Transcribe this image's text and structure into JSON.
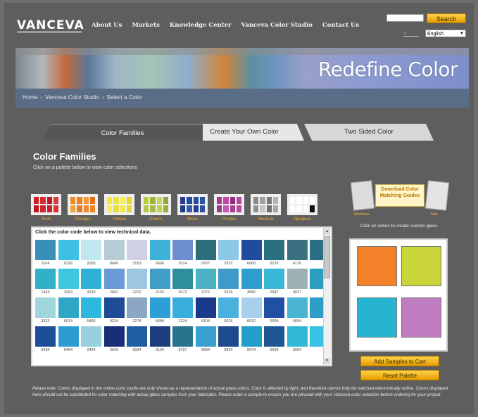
{
  "header": {
    "logo": "VANCEVA",
    "nav": [
      "About Us",
      "Markets",
      "Knowledge Center",
      "Vanceva Color Studio",
      "Contact Us"
    ],
    "search_button": "Search",
    "search_placeholder": "",
    "language": "English"
  },
  "banner": {
    "title": "Redefine Color",
    "breadcrumb": [
      "Home",
      "Vanceva Color Studio",
      "Select a Color"
    ]
  },
  "tabs": [
    "Color Families",
    "Create Your Own Color",
    "Two Sided Color"
  ],
  "section": {
    "title": "Color Families",
    "subtitle": "Click on a palette below to view color selections"
  },
  "palettes": [
    {
      "label": "Reds",
      "colors": [
        "#cc1f2a",
        "#d62a34",
        "#c0142a",
        "#d93a3a",
        "#b81822",
        "#cf2430",
        "#c52030",
        "#dd3030"
      ]
    },
    {
      "label": "Oranges",
      "colors": [
        "#f08a1f",
        "#ee7e22",
        "#f39a2f",
        "#e26d1c",
        "#f2a03a",
        "#e77a28",
        "#f18a30",
        "#eb8624"
      ]
    },
    {
      "label": "Yellows",
      "colors": [
        "#f5e93a",
        "#efe04a",
        "#f3f05a",
        "#e8d62e",
        "#f6ef60",
        "#ecde3e",
        "#f2e84a",
        "#e6d63a"
      ]
    },
    {
      "label": "Greens",
      "colors": [
        "#bccc3c",
        "#9fb23a",
        "#c8d55a",
        "#8aa838",
        "#b3c648",
        "#a6ba44",
        "#c4d04c",
        "#98b040"
      ]
    },
    {
      "label": "Blues",
      "colors": [
        "#2a3a8e",
        "#1e4ea0",
        "#30489a",
        "#2854a8",
        "#1c3c86",
        "#3a5ab0",
        "#223e90",
        "#2c52a0"
      ]
    },
    {
      "label": "Purples",
      "colors": [
        "#a83a8e",
        "#c04aa0",
        "#8e2e80",
        "#b448a0",
        "#9c3a8a",
        "#c25ab0",
        "#a8408e",
        "#b84c9e"
      ]
    },
    {
      "label": "Neutrals",
      "colors": [
        "#8a8a8a",
        "#a0a0a0",
        "#787878",
        "#b4b4b4",
        "#909090",
        "#c4c4c4",
        "#6e6e6e",
        "#a8a8a8"
      ]
    },
    {
      "label": "Opaques",
      "colors": [
        "#ffffff",
        "#ffffff",
        "#ffffff",
        "#ffffff",
        "#ffffff",
        "#ffffff",
        "#ffffff",
        "#111111"
      ]
    }
  ],
  "codes": {
    "header": "Click the color code below to view technical data.",
    "rows": [
      {
        "colors": [
          "#3a8fb8",
          "#3ec0e6",
          "#bfe8ee",
          "#b8ccd6",
          "#cfd0e6",
          "#3fb2d8",
          "#6e8fcf",
          "#2e6e7a",
          "#8bc8e8",
          "#1f4c9e",
          "#2a7080",
          "#3a7080",
          "#2c6e86"
        ],
        "codes": [
          "1164",
          "0226",
          "2003",
          "8666",
          "3153",
          "0606",
          "2014",
          "9767",
          "2522",
          "6668",
          "6276",
          "4176",
          ""
        ]
      },
      {
        "colors": [
          "#31b0c8",
          "#3ec6de",
          "#2fb0d6",
          "#6c9ad6",
          "#9ec6e0",
          "#3f9ec8",
          "#2e8e9c",
          "#4ab2c2",
          "#3e9ac8",
          "#2e9ed0",
          "#3bb8d8",
          "#9eb0b4",
          "#2b9ec0"
        ],
        "codes": [
          "1443",
          "3263",
          "3233",
          "2662",
          "2222",
          "2132",
          "2672",
          "2072",
          "3226",
          "3666",
          "2587",
          "9027",
          ""
        ]
      },
      {
        "colors": [
          "#9ed6dc",
          "#30a6c6",
          "#2eb8e0",
          "#1f4c96",
          "#8ca6c4",
          "#2e9ed6",
          "#3aaeda",
          "#1c3a8a",
          "#4ab0de",
          "#a8d0ec",
          "#1f50a6",
          "#4ab4d2",
          "#2e9ec6"
        ],
        "codes": [
          "3322",
          "6614",
          "6466",
          "0224",
          "2274",
          "6684",
          "2224",
          "5104",
          "0626",
          "6612",
          "0004",
          "6664",
          ""
        ]
      },
      {
        "colors": [
          "#1e4e98",
          "#2e9cd2",
          "#98d0e0",
          "#1a2e78",
          "#1e5ea0",
          "#1f3e7e",
          "#28748e",
          "#3aa0d2",
          "#1d4a8e",
          "#229ec8",
          "#1e5694",
          "#30b8d6",
          "#3ac0e0"
        ],
        "codes": [
          "0434",
          "0464",
          "0424",
          "3043",
          "0024",
          "0124",
          "3707",
          "0664",
          "0624",
          "0674",
          "0004",
          "6064",
          ""
        ]
      }
    ]
  },
  "guide": {
    "title": "Download Color Matching Guides",
    "caption_left": "Windows",
    "caption_right": "Mac"
  },
  "preview": {
    "hint": "Click on colors to create custom glass.",
    "colors": [
      "#f2812a",
      "#c9d538",
      "#26b4d0",
      "#c07cc0"
    ]
  },
  "buttons": {
    "add_samples": "Add Samples to Cart",
    "reset": "Reset Palette"
  },
  "note": "Please note: Colors displayed in the online color studio are only shown as a representation of actual glass colors. Color is affected by light, and therefore cannot truly be matched electronically online. Colors displayed here should not be substituted for color matching with actual glass samples from your fabricator. Please order a sample to ensure you are pleased with your Vanceva color selection before ordering for your project."
}
